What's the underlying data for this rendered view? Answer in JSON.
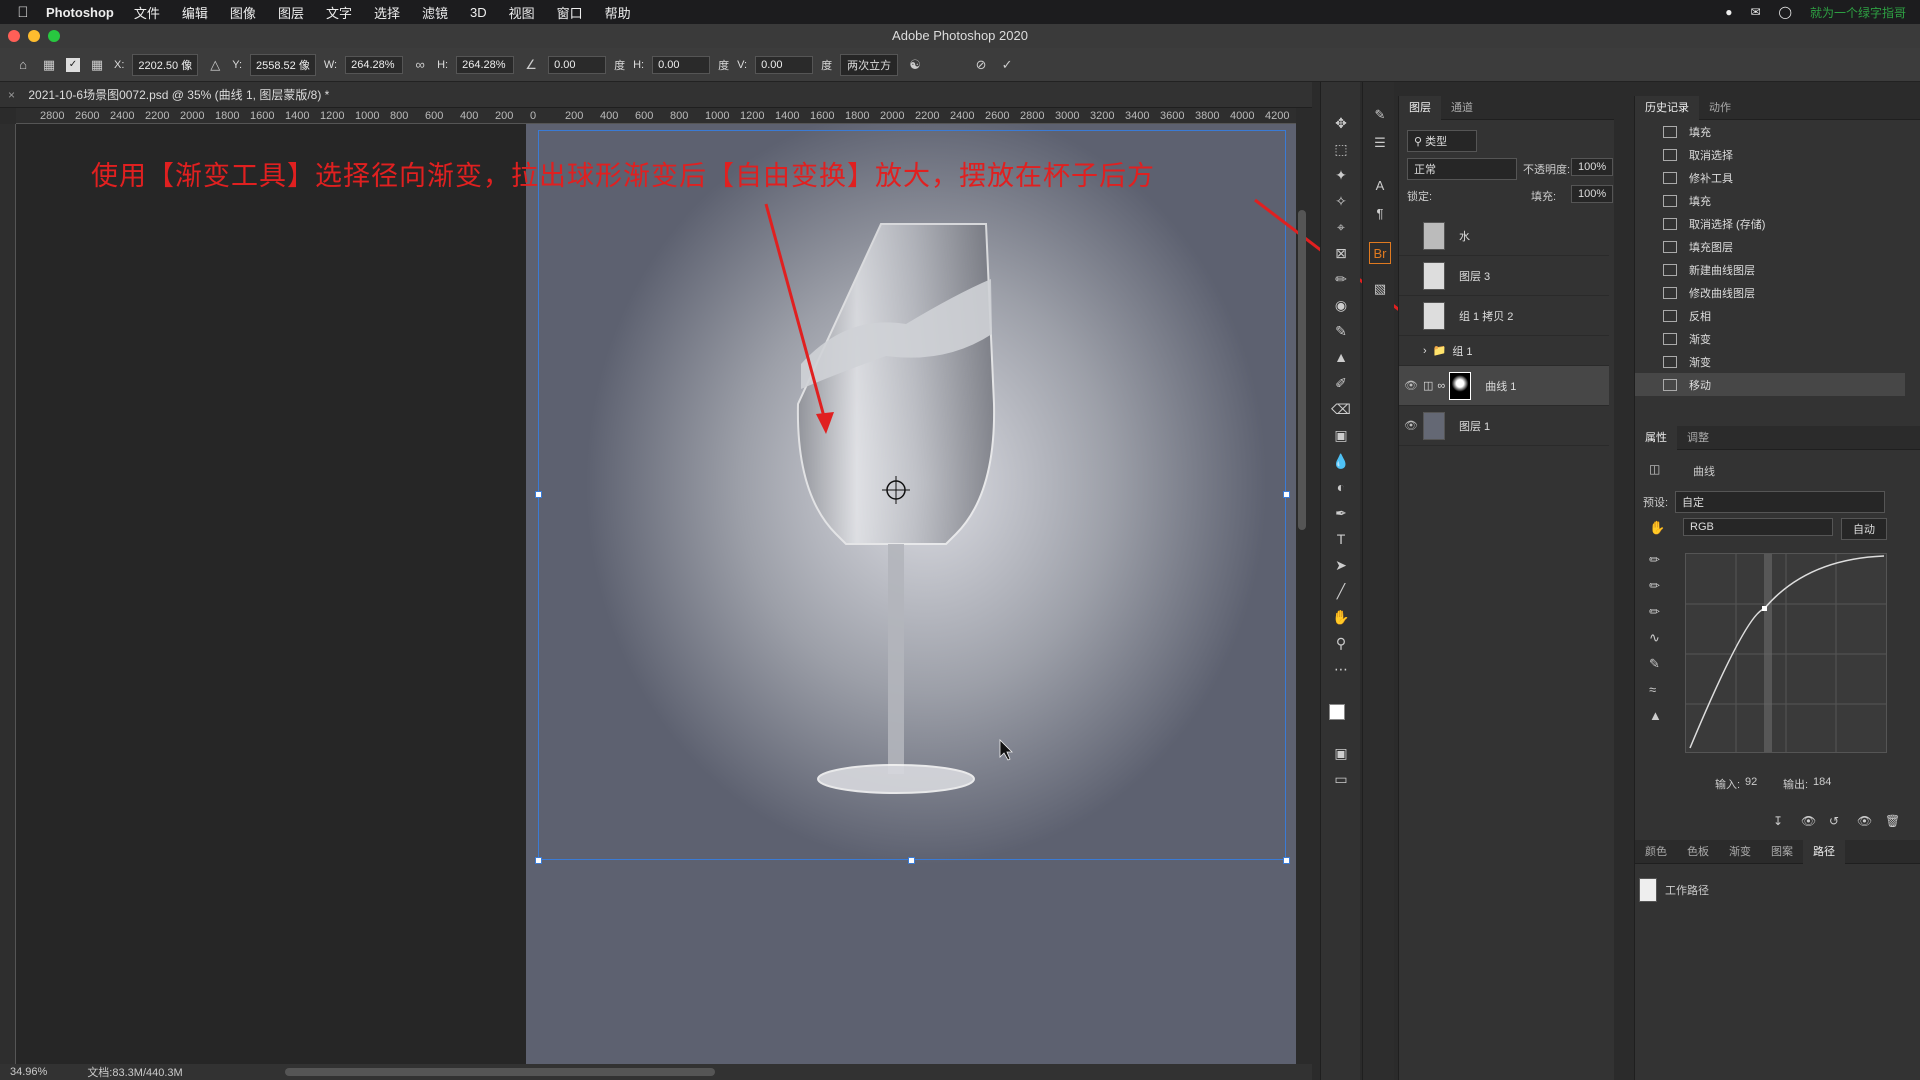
{
  "menubar": {
    "app_name": "Photoshop",
    "items": [
      "文件",
      "编辑",
      "图像",
      "图层",
      "文字",
      "选择",
      "滤镜",
      "3D",
      "视图",
      "窗口",
      "帮助"
    ],
    "right_text": "就为一个绿字指哥"
  },
  "window": {
    "title": "Adobe Photoshop 2020"
  },
  "options_bar": {
    "x_label": "X:",
    "x_value": "2202.50 像",
    "y_label": "Y:",
    "y_value": "2558.52 像",
    "w_label": "W:",
    "w_value": "264.28%",
    "h_label": "H:",
    "h_value": "264.28%",
    "angle_value": "0.00",
    "angle_unit": "度",
    "hskew_label": "H:",
    "hskew_value": "0.00",
    "hskew_unit": "度",
    "vskew_label": "V:",
    "vskew_value": "0.00",
    "vskew_unit": "度",
    "interpolation": "两次立方"
  },
  "document": {
    "tab_title": "2021-10-6场景图0072.psd @ 35% (曲线 1, 图层蒙版/8) *",
    "annotation": "使用【渐变工具】选择径向渐变，拉出球形渐变后【自由变换】放大，摆放在杯子后方",
    "ruler_labels": [
      "2800",
      "2600",
      "2400",
      "2200",
      "2000",
      "1800",
      "1600",
      "1400",
      "1200",
      "1000",
      "800",
      "600",
      "400",
      "200",
      "0",
      "200",
      "400",
      "600",
      "800",
      "1000",
      "1200",
      "1400",
      "1600",
      "1800",
      "2000",
      "2200",
      "2400",
      "2600",
      "2800",
      "3000",
      "3200",
      "3400",
      "3600",
      "3800",
      "4000",
      "4200"
    ]
  },
  "status": {
    "zoom": "34.96%",
    "doc_size": "文档:83.3M/440.3M"
  },
  "layers_panel": {
    "tabs": [
      "图层",
      "通道"
    ],
    "search_placeholder": "类型",
    "blend_mode": "正常",
    "opacity_label": "不透明度:",
    "opacity": "100%",
    "lock_label": "锁定:",
    "fill_label": "填充:",
    "fill": "100%",
    "layers": [
      {
        "name": "水",
        "visible": false
      },
      {
        "name": "图层 3",
        "visible": false
      },
      {
        "name": "组 1 拷贝 2",
        "visible": false
      },
      {
        "name": "组 1",
        "visible": false
      },
      {
        "name": "曲线 1",
        "visible": true,
        "selected": true
      },
      {
        "name": "图层 1",
        "visible": true
      }
    ]
  },
  "history_panel": {
    "tabs": [
      "历史记录",
      "动作"
    ],
    "items": [
      "填充",
      "取消选择",
      "修补工具",
      "填充",
      "取消选择 (存储)",
      "填充图层",
      "新建曲线图层",
      "修改曲线图层",
      "反相",
      "渐变",
      "渐变",
      "移动"
    ]
  },
  "properties_panel": {
    "tabs": [
      "属性",
      "调整"
    ],
    "type": "曲线",
    "preset_label": "预设:",
    "preset": "自定",
    "channel": "RGB",
    "auto_label": "自动",
    "input_label": "输入:",
    "input_value": "92",
    "output_label": "输出:",
    "output_value": "184"
  },
  "paths_panel": {
    "tabs": [
      "颜色",
      "色板",
      "渐变",
      "图案",
      "路径"
    ],
    "active_tab": "路径",
    "items": [
      "工作路径"
    ]
  },
  "colors": {
    "annotation": "#e02020",
    "selection": "#3a7bd5",
    "arrow": "#e02020"
  }
}
